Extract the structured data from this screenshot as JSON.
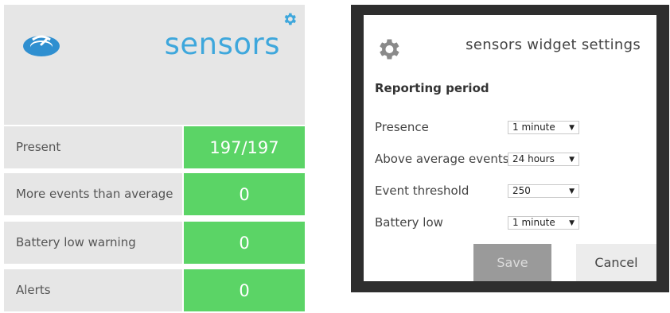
{
  "widget": {
    "title": "sensors",
    "rows": [
      {
        "label": "Present",
        "value": "197/197"
      },
      {
        "label": "More events than average",
        "value": "0"
      },
      {
        "label": "Battery low warning",
        "value": "0"
      },
      {
        "label": "Alerts",
        "value": "0"
      }
    ],
    "icons": {
      "logo": "gauge-logo",
      "settings": "gear-icon"
    },
    "colors": {
      "accent": "#3ea7dc",
      "value_bg": "#5bd466",
      "label_bg": "#e6e6e6"
    }
  },
  "settings": {
    "title": "sensors widget settings",
    "section": "Reporting period",
    "fields": [
      {
        "label": "Presence",
        "value": "1 minute"
      },
      {
        "label": "Above average events",
        "value": "24 hours"
      },
      {
        "label": "Event threshold",
        "value": "250"
      },
      {
        "label": "Battery low",
        "value": "1 minute"
      }
    ],
    "save_label": "Save",
    "cancel_label": "Cancel"
  }
}
